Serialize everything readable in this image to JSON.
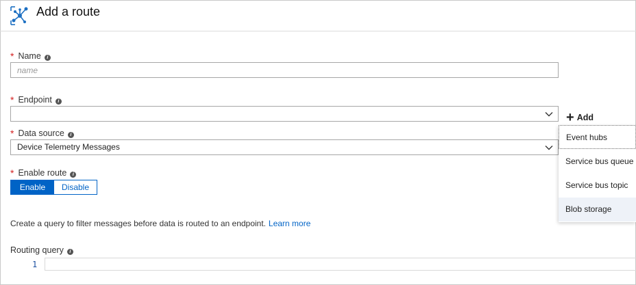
{
  "header": {
    "title": "Add a route",
    "icon": "route-network-icon"
  },
  "form": {
    "name": {
      "label": "Name",
      "required_mark": "*",
      "placeholder": "name",
      "value": ""
    },
    "endpoint": {
      "label": "Endpoint",
      "required_mark": "*",
      "value": ""
    },
    "add": {
      "label": "Add",
      "plus": "+"
    },
    "endpoint_menu": {
      "items": [
        "Event hubs",
        "Service bus queue",
        "Service bus topic",
        "Blob storage"
      ]
    },
    "data_source": {
      "label": "Data source",
      "required_mark": "*",
      "value": "Device Telemetry Messages"
    },
    "enable_route": {
      "label": "Enable route",
      "required_mark": "*",
      "enable": "Enable",
      "disable": "Disable",
      "selected": "Enable"
    },
    "query_help": {
      "text": "Create a query to filter messages before data is routed to an endpoint.",
      "link": "Learn more"
    },
    "routing_query": {
      "label": "Routing query",
      "line_number": "1",
      "value": ""
    }
  },
  "colors": {
    "accent": "#0063c6",
    "required": "#d32020"
  }
}
